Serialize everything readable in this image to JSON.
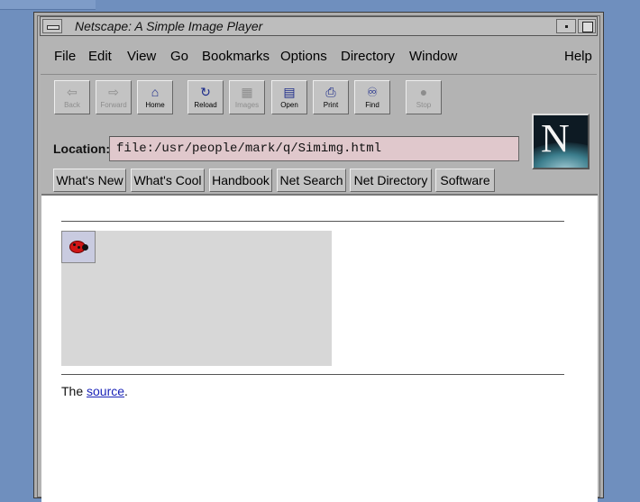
{
  "window": {
    "title": "Netscape: A Simple Image Player"
  },
  "menu": [
    {
      "id": "file",
      "label": "File"
    },
    {
      "id": "edit",
      "label": "Edit"
    },
    {
      "id": "view",
      "label": "View"
    },
    {
      "id": "go",
      "label": "Go"
    },
    {
      "id": "bookmarks",
      "label": "Bookmarks"
    },
    {
      "id": "options",
      "label": "Options"
    },
    {
      "id": "directory",
      "label": "Directory"
    },
    {
      "id": "window",
      "label": "Window"
    },
    {
      "id": "help",
      "label": "Help"
    }
  ],
  "toolbar": [
    {
      "id": "back",
      "label": "Back",
      "icon": "back-arrow-icon",
      "enabled": false
    },
    {
      "id": "forward",
      "label": "Forward",
      "icon": "forward-arrow-icon",
      "enabled": false
    },
    {
      "id": "home",
      "label": "Home",
      "icon": "home-icon",
      "enabled": true
    },
    {
      "id": "reload",
      "label": "Reload",
      "icon": "reload-icon",
      "enabled": true
    },
    {
      "id": "images",
      "label": "Images",
      "icon": "images-icon",
      "enabled": false
    },
    {
      "id": "open",
      "label": "Open",
      "icon": "open-icon",
      "enabled": true
    },
    {
      "id": "print",
      "label": "Print",
      "icon": "print-icon",
      "enabled": true
    },
    {
      "id": "find",
      "label": "Find",
      "icon": "binoculars-icon",
      "enabled": true
    },
    {
      "id": "stop",
      "label": "Stop",
      "icon": "stop-icon",
      "enabled": false
    }
  ],
  "location": {
    "label": "Location:",
    "value": "file:/usr/people/mark/q/Simimg.html"
  },
  "directory_buttons": [
    {
      "id": "whats-new",
      "label": "What's New"
    },
    {
      "id": "whats-cool",
      "label": "What's Cool"
    },
    {
      "id": "handbook",
      "label": "Handbook"
    },
    {
      "id": "net-search",
      "label": "Net Search"
    },
    {
      "id": "net-directory",
      "label": "Net Directory"
    },
    {
      "id": "software",
      "label": "Software"
    }
  ],
  "page": {
    "source_prefix": "The",
    "source_link": "source",
    "source_suffix": "."
  },
  "colors": {
    "desktop": "#6f8fbe",
    "location_bg": "#e0c8cc",
    "link": "#1a23b8",
    "ladybug": "#d01616"
  }
}
